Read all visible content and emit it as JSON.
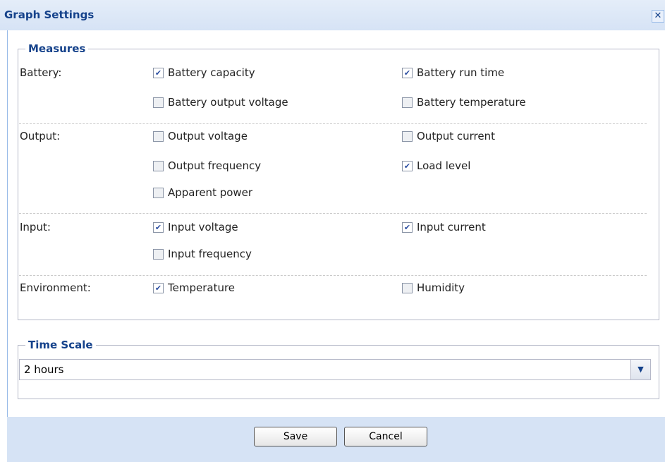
{
  "dialog": {
    "title": "Graph Settings",
    "close_glyph": "✕"
  },
  "measures": {
    "legend": "Measures",
    "groups": [
      {
        "label": "Battery:",
        "items": [
          {
            "label": "Battery capacity",
            "checked": true
          },
          {
            "label": "Battery run time",
            "checked": true
          },
          {
            "label": "Battery output voltage",
            "checked": false
          },
          {
            "label": "Battery temperature",
            "checked": false
          }
        ]
      },
      {
        "label": "Output:",
        "items": [
          {
            "label": "Output voltage",
            "checked": false
          },
          {
            "label": "Output current",
            "checked": false
          },
          {
            "label": "Output frequency",
            "checked": false
          },
          {
            "label": "Load level",
            "checked": true
          },
          {
            "label": "Apparent power",
            "checked": false
          }
        ]
      },
      {
        "label": "Input:",
        "items": [
          {
            "label": "Input voltage",
            "checked": true
          },
          {
            "label": "Input current",
            "checked": true
          },
          {
            "label": "Input frequency",
            "checked": false
          }
        ]
      },
      {
        "label": "Environment:",
        "items": [
          {
            "label": "Temperature",
            "checked": true
          },
          {
            "label": "Humidity",
            "checked": false
          }
        ]
      }
    ]
  },
  "time_scale": {
    "legend": "Time Scale",
    "selected": "2 hours"
  },
  "footer": {
    "save_label": "Save",
    "cancel_label": "Cancel"
  },
  "colors": {
    "title": "#15428b",
    "header_bg": "#d6e3f5",
    "check": "#2a4da1"
  }
}
